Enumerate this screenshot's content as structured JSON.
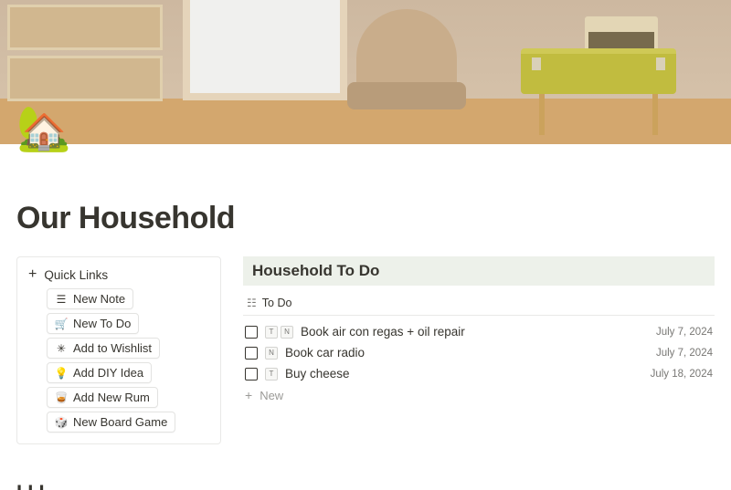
{
  "page": {
    "icon": "🏡",
    "title": "Our Household"
  },
  "quick_links": {
    "header": "Quick Links",
    "items": [
      {
        "icon": "☰",
        "label": "New Note"
      },
      {
        "icon": "🛒",
        "label": "New To Do"
      },
      {
        "icon": "✳",
        "label": "Add to Wishlist"
      },
      {
        "icon": "💡",
        "label": "Add DIY Idea"
      },
      {
        "icon": "🥃",
        "label": "Add New Rum"
      },
      {
        "icon": "🎲",
        "label": "New Board Game"
      }
    ]
  },
  "todo_section": {
    "title": "Household To Do",
    "view_label": "To Do",
    "new_label": "New",
    "items": [
      {
        "tags": [
          "T",
          "N"
        ],
        "title": "Book air con regas + oil repair",
        "date": "July 7, 2024"
      },
      {
        "tags": [
          "N"
        ],
        "title": "Book car radio",
        "date": "July 7, 2024"
      },
      {
        "tags": [
          "T"
        ],
        "title": "Buy cheese",
        "date": "July 18, 2024"
      }
    ]
  },
  "next_section_peek": "I I  I"
}
